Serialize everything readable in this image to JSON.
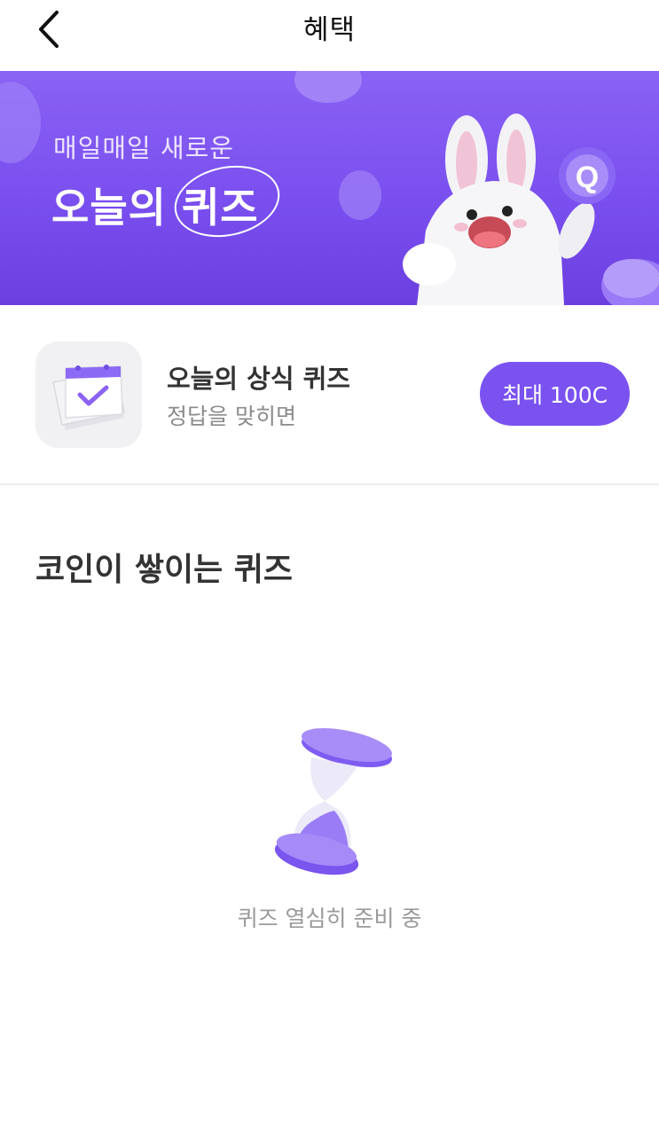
{
  "header": {
    "title": "혜택"
  },
  "banner": {
    "subtitle": "매일매일 새로운",
    "title": "오늘의 퀴즈"
  },
  "daily_quiz": {
    "title": "오늘의 상식 퀴즈",
    "subtitle": "정답을 맞히면",
    "reward_button": "최대 100C"
  },
  "section": {
    "title": "코인이 쌓이는 퀴즈"
  },
  "empty_state": {
    "message": "퀴즈 열심히 준비 중"
  },
  "colors": {
    "accent": "#7a52f0",
    "banner": "#7a4fef"
  }
}
